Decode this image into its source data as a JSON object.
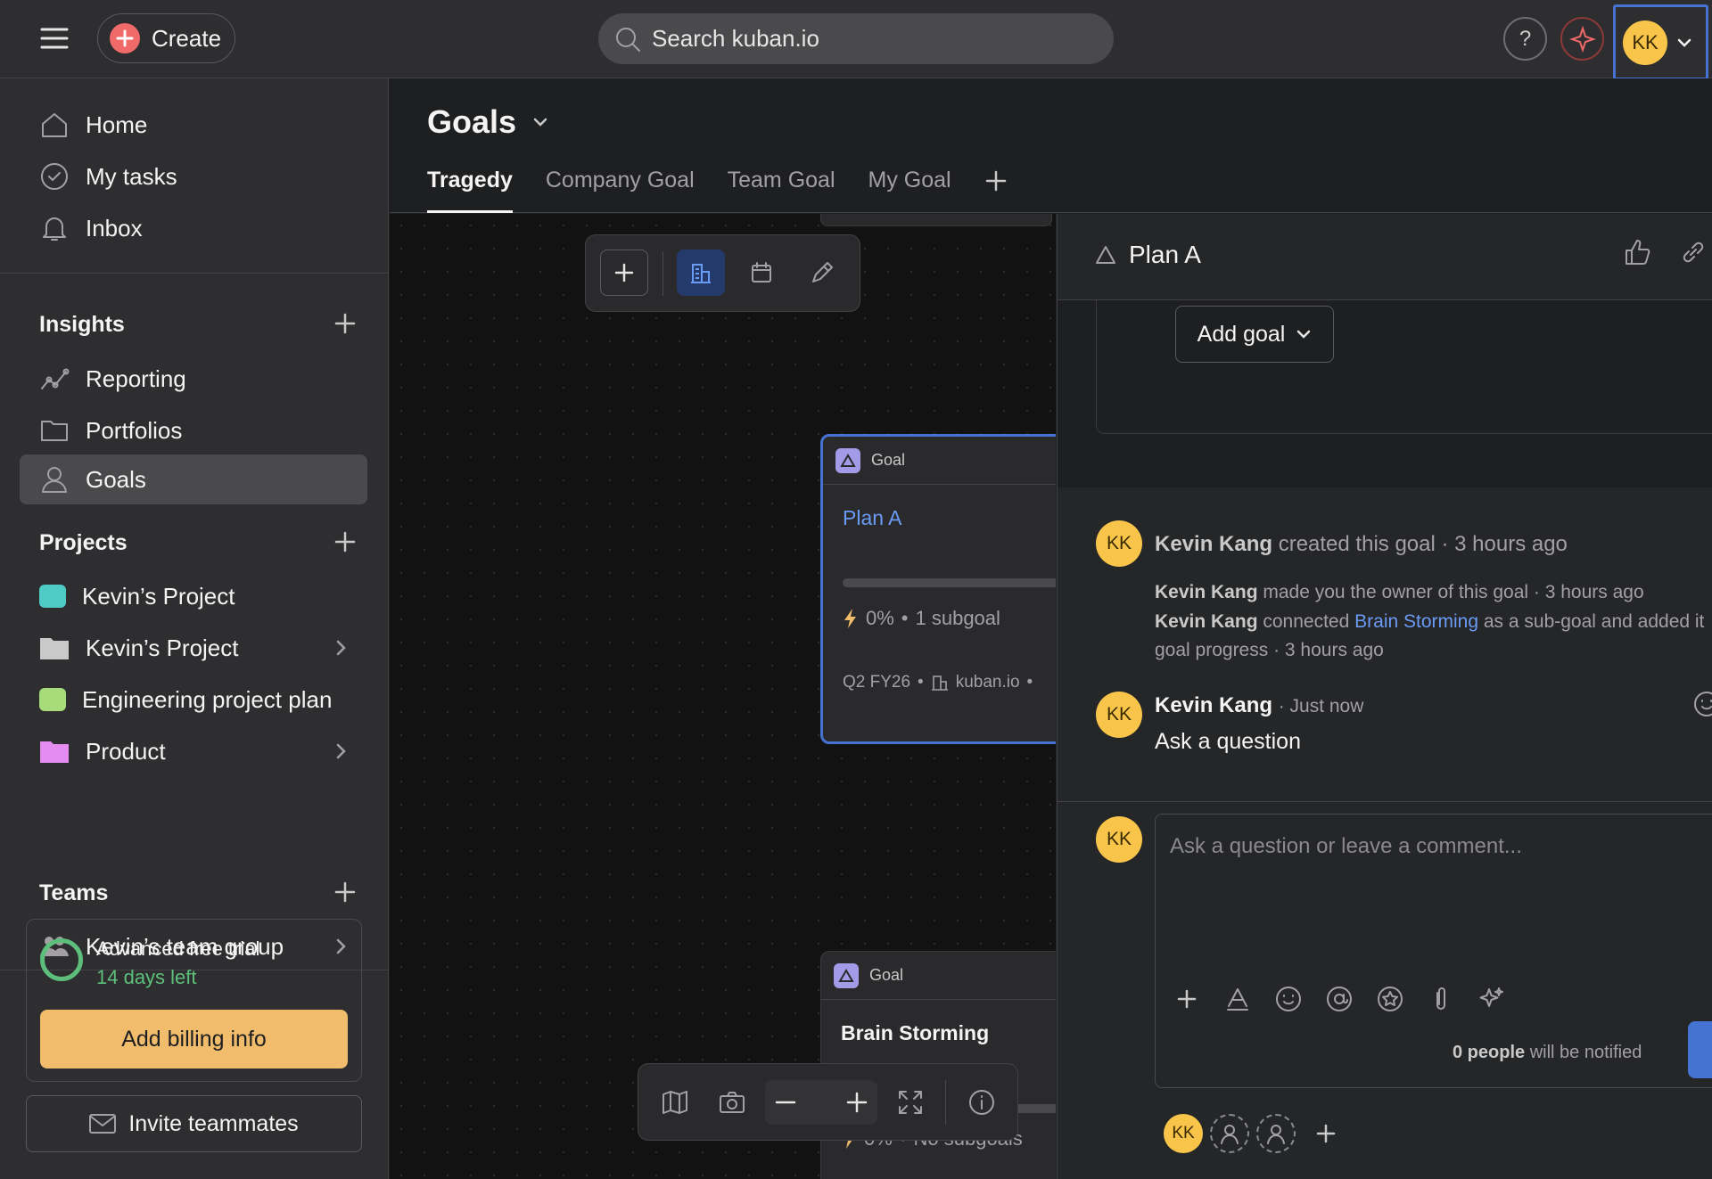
{
  "topbar": {
    "create_label": "Create",
    "search_placeholder": "Search kuban.io",
    "help_label": "?",
    "avatar_initials": "KK"
  },
  "sidebar": {
    "nav": [
      {
        "label": "Home",
        "icon": "home-icon"
      },
      {
        "label": "My tasks",
        "icon": "check-circle-icon"
      },
      {
        "label": "Inbox",
        "icon": "bell-icon"
      }
    ],
    "insights": {
      "title": "Insights",
      "items": [
        {
          "label": "Reporting",
          "icon": "chart-line-icon"
        },
        {
          "label": "Portfolios",
          "icon": "folder-icon"
        },
        {
          "label": "Goals",
          "icon": "person-icon",
          "active": true
        }
      ]
    },
    "projects": {
      "title": "Projects",
      "items": [
        {
          "label": "Kevin’s Project",
          "swatch": "#4ecbc4"
        },
        {
          "label": "Kevin’s Project",
          "swatch": "#c9c9c9",
          "folder": true
        },
        {
          "label": "Engineering project plan",
          "swatch": "#a8dc7a"
        },
        {
          "label": "Product",
          "swatch": "#e48cf0",
          "folder": true
        }
      ]
    },
    "teams": {
      "title": "Teams",
      "items": [
        {
          "label": "Kevin’s team group",
          "icon": "team-icon"
        }
      ]
    },
    "trial": {
      "title": "Advanced free trial",
      "days": "14 days left",
      "billing_label": "Add billing info"
    },
    "invite_label": "Invite teammates"
  },
  "main": {
    "title": "Goals",
    "tabs": [
      "Tragedy",
      "Company Goal",
      "Team Goal",
      "My Goal"
    ],
    "active_tab": 0
  },
  "canvas": {
    "cards": [
      {
        "type": "Goal",
        "title": "Plan A",
        "progress": "0%",
        "subgoals": "1 subgoal",
        "period": "Q2 FY26",
        "workspace": "kuban.io",
        "selected": true
      },
      {
        "type": "Goal",
        "title": "Brain Storming",
        "progress": "0%",
        "subgoals": "No subgoals",
        "selected": false
      }
    ]
  },
  "panel": {
    "title": "Plan A",
    "add_goal_label": "Add goal",
    "feed": {
      "created": {
        "author": "Kevin Kang",
        "action": "created this goal",
        "time": "· 3 hours ago"
      },
      "owner": {
        "author": "Kevin Kang",
        "action": "made you the owner of this goal",
        "time": "· 3 hours ago"
      },
      "connected": {
        "author": "Kevin Kang",
        "action1": "connected",
        "link": "Brain Storming",
        "action2": "as a sub-goal and added it",
        "line2": "goal progress · 3 hours ago"
      },
      "comment": {
        "author": "Kevin Kang",
        "time": "· Just now",
        "text": "Ask a question"
      }
    },
    "comment_placeholder": "Ask a question or leave a comment...",
    "notify_count": "0 people",
    "notify_rest": "will be notified"
  }
}
